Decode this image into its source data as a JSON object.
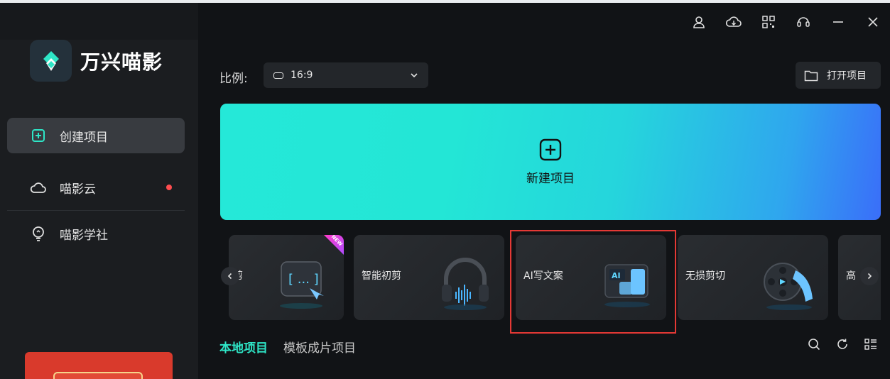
{
  "app": {
    "name": "万兴喵影"
  },
  "sidebar": {
    "items": [
      {
        "label": "创建项目",
        "icon": "create-project-icon",
        "active": true
      },
      {
        "label": "喵影云",
        "icon": "cloud-icon",
        "badge": "dot"
      },
      {
        "label": "喵影学社",
        "icon": "lightbulb-icon"
      }
    ]
  },
  "titlebar": {
    "icons": [
      "account-icon",
      "cloud-sync-icon",
      "qr-code-icon",
      "headset-support-icon",
      "minimize-icon",
      "close-icon"
    ]
  },
  "toolbar": {
    "ratio_label": "比例:",
    "ratio_value": "16:9",
    "open_project_label": "打开项目"
  },
  "new_project": {
    "label": "新建项目"
  },
  "feature_cards": [
    {
      "label": "剪",
      "has_new_tag": true,
      "new_tag_text": "NEW"
    },
    {
      "label": "智能初剪"
    },
    {
      "label": "AI写文案",
      "highlighted": true
    },
    {
      "label": "无损剪切"
    },
    {
      "label": "高"
    }
  ],
  "tabs": [
    {
      "label": "本地项目",
      "active": true
    },
    {
      "label": "模板成片项目",
      "active": false
    }
  ],
  "list_tools": [
    "search-icon",
    "refresh-icon",
    "list-view-icon"
  ],
  "colors": {
    "accent": "#2ee6c7",
    "highlight_border": "#e53935",
    "badge": "#ff4d4f"
  }
}
